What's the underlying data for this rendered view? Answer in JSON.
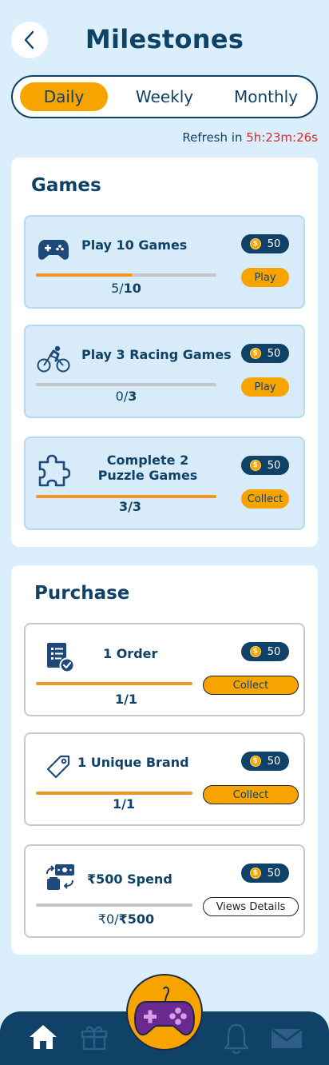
{
  "header": {
    "title": "Milestones",
    "back_icon": "chevron-left-icon"
  },
  "tabs": [
    {
      "label": "Daily",
      "active": true
    },
    {
      "label": "Weekly",
      "active": false
    },
    {
      "label": "Monthly",
      "active": false
    }
  ],
  "refresh": {
    "label": "Refresh in",
    "time": "5h:23m:26s"
  },
  "sections": [
    {
      "title": "Games",
      "cards": [
        {
          "icon": "gamepad-icon",
          "title": "Play 10 Games",
          "reward": "50",
          "progress_current": "5",
          "progress_sep": "/",
          "progress_total": "10",
          "progress": 0.53,
          "action": "Play"
        },
        {
          "icon": "cyclist-icon",
          "title": "Play 3 Racing Games",
          "reward": "50",
          "progress_current": "0",
          "progress_sep": "/",
          "progress_total": "3",
          "progress": 0.0,
          "action": "Play"
        },
        {
          "icon": "puzzle-icon",
          "title": "Complete 2 Puzzle Games",
          "reward": "50",
          "progress_text": "3/3",
          "progress": 1.0,
          "action": "Collect"
        }
      ]
    },
    {
      "title": "Purchase",
      "cards": [
        {
          "icon": "order-list-icon",
          "title": "1 Order",
          "reward": "50",
          "progress_text": "1/1",
          "progress": 1.0,
          "action": "Collect"
        },
        {
          "icon": "tag-icon",
          "title": "1 Unique Brand",
          "reward": "50",
          "progress_text": "1/1",
          "progress": 1.0,
          "action": "Collect"
        },
        {
          "icon": "money-transfer-icon",
          "title": "₹500 Spend",
          "reward": "50",
          "progress_current": "₹0",
          "progress_sep": "/",
          "progress_total": "₹500",
          "progress": 0.0,
          "action": "Views Details"
        }
      ]
    }
  ],
  "coin_symbol": "$",
  "bottom_nav": [
    {
      "icon": "home-icon",
      "active": true
    },
    {
      "icon": "gift-icon",
      "active": false
    },
    {
      "icon": "game-controller-icon",
      "active": false
    },
    {
      "icon": "bell-icon",
      "active": false
    },
    {
      "icon": "mail-icon",
      "active": false
    }
  ],
  "colors": {
    "primary": "#0f4266",
    "accent": "#f7a300",
    "progress": "#f39322",
    "alert": "#e0252b",
    "background": "#dbeefb"
  }
}
